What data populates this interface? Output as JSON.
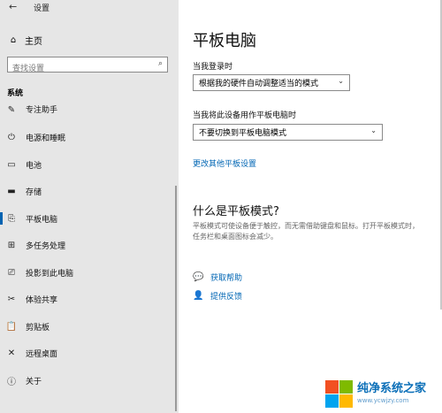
{
  "window": {
    "title": "设置",
    "back_glyph": "←"
  },
  "sidebar": {
    "home": {
      "icon": "⌂",
      "label": "主页"
    },
    "search": {
      "placeholder": "查找设置",
      "icon": "⌕"
    },
    "group": "系统",
    "partial_item": {
      "icon": "✎",
      "label": "专注助手"
    },
    "items": [
      {
        "icon": "⏻",
        "label": "电源和睡眠"
      },
      {
        "icon": "▭",
        "label": "电池"
      },
      {
        "icon": "▬",
        "label": "存储"
      },
      {
        "icon": "⎘",
        "label": "平板电脑"
      },
      {
        "icon": "⊞",
        "label": "多任务处理"
      },
      {
        "icon": "⎚",
        "label": "投影到此电脑"
      },
      {
        "icon": "✂",
        "label": "体验共享"
      },
      {
        "icon": "📋",
        "label": "剪贴板"
      },
      {
        "icon": "✕",
        "label": "远程桌面"
      },
      {
        "icon": "ⓘ",
        "label": "关于"
      }
    ],
    "active_index": 3
  },
  "main": {
    "title": "平板电脑",
    "signin_label": "当我登录时",
    "signin_value": "根据我的硬件自动调整适当的模式",
    "tablet_label": "当我将此设备用作平板电脑时",
    "tablet_value": "不要切换到平板电脑模式",
    "more_link": "更改其他平板设置",
    "section_title": "什么是平板模式?",
    "para_line1": "平板模式可使设备便于触控，而无需借助键盘和鼠标。打开平板模式时，",
    "para_line2": "任务栏和桌面图标会减少。",
    "help": {
      "icon": "💬",
      "label": "获取帮助"
    },
    "feedback": {
      "icon": "👤",
      "label": "提供反馈"
    }
  },
  "watermark": {
    "line1": "纯净系统之家",
    "line2": "www.ycwjzy.com"
  },
  "colors": {
    "accent": "#0063b1",
    "link": "#0066b4",
    "sidebar_bg": "#e6e6e6"
  }
}
